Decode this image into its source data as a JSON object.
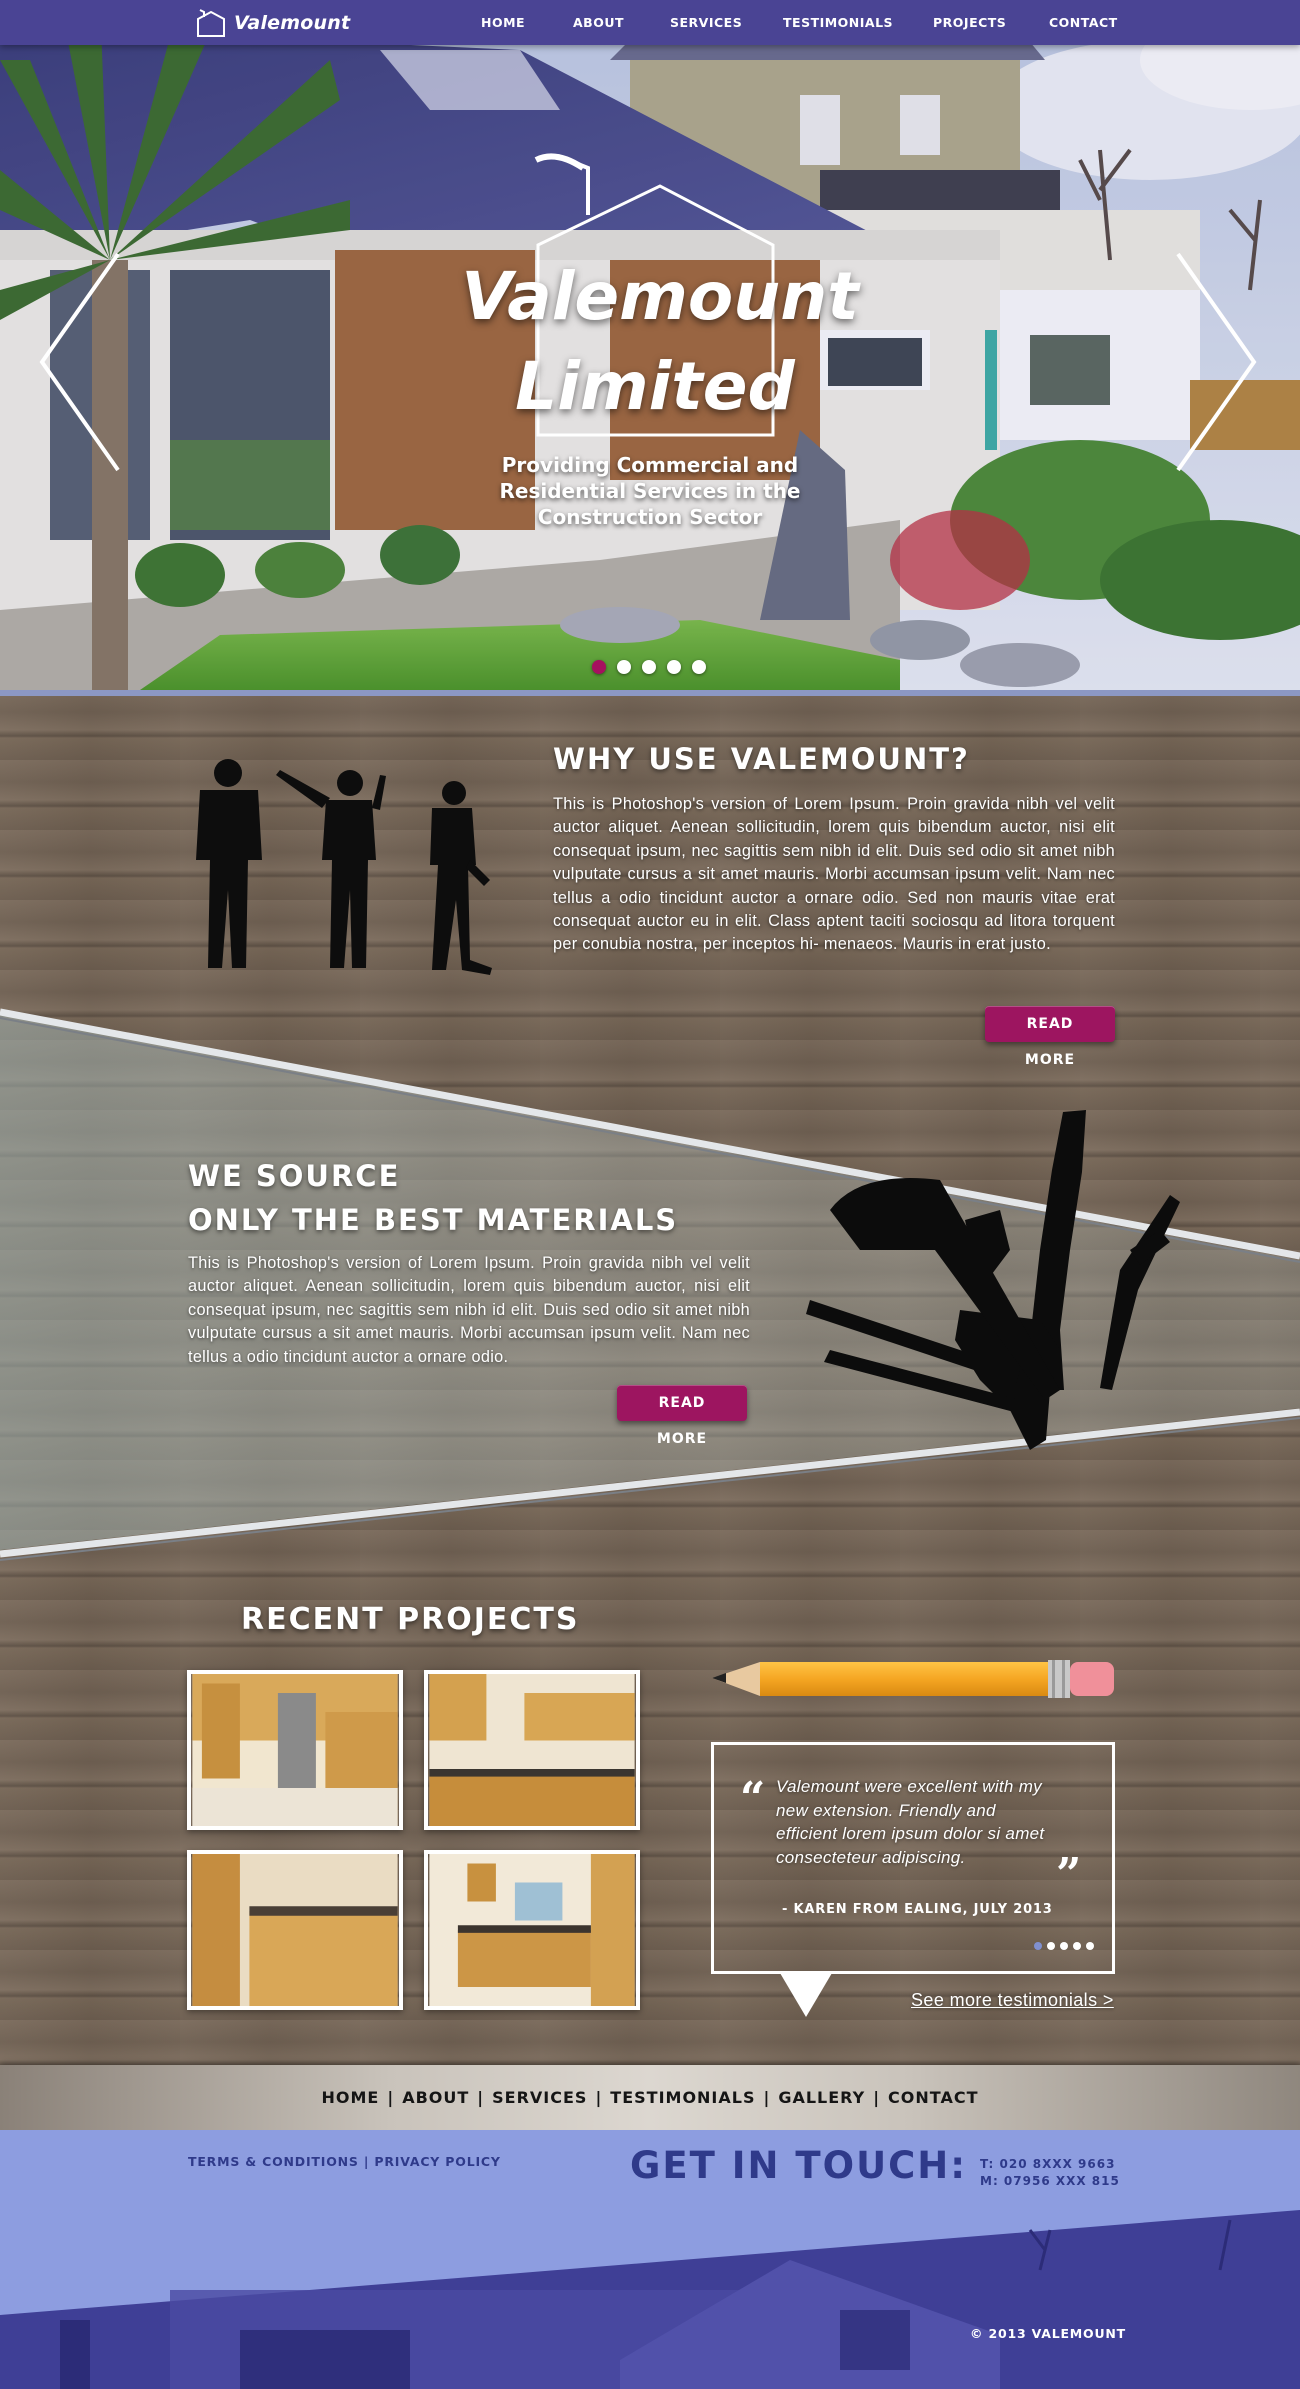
{
  "brand": {
    "name": "Valemount"
  },
  "nav": {
    "items": [
      "HOME",
      "ABOUT",
      "SERVICES",
      "TESTIMONIALS",
      "PROJECTS",
      "CONTACT"
    ]
  },
  "hero": {
    "title_line1": "Valemount",
    "title_line2": "Limited",
    "subtitle": "Providing Commercial and Residential Services in the Construction Sector",
    "slide_count": 5,
    "active_slide": 1
  },
  "why": {
    "heading": "WHY USE VALEMOUNT?",
    "body": "This is Photoshop's version  of Lorem Ipsum. Proin gravida nibh vel velit auctor aliquet. Aenean sollicitudin, lorem quis bibendum auctor, nisi elit consequat ipsum, nec sagittis sem nibh id elit. Duis sed odio sit amet nibh vulputate cursus a sit amet mauris. Morbi accumsan ipsum velit. Nam nec tellus a odio tincidunt auctor a ornare odio. Sed non  mauris vitae erat consequat auctor eu in elit. Class aptent taciti sociosqu ad litora torquent per conubia nostra, per inceptos hi- menaeos. Mauris in erat justo.",
    "button": "READ MORE"
  },
  "materials": {
    "heading_line1": "WE SOURCE",
    "heading_line2": "ONLY THE BEST MATERIALS",
    "body": "This is Photoshop's version  of Lorem Ipsum. Proin gravida nibh vel velit auctor aliquet. Aenean sollicitudin, lorem quis bibendum auctor, nisi elit consequat ipsum, nec sagittis sem nibh id elit. Duis sed odio sit amet nibh vulputate cursus a sit amet mauris. Morbi accumsan ipsum velit. Nam nec tellus a odio tincidunt auctor a ornare odio.",
    "button": "READ MORE"
  },
  "projects": {
    "heading": "RECENT PROJECTS"
  },
  "testimonial": {
    "quote": "Valemount were excellent with my new extension. Friendly and efficient lorem ipsum dolor si amet consecteteur adipiscing.",
    "author": "- KAREN FROM EALING, JULY 2013",
    "open_mark": "“",
    "close_mark": "”",
    "slide_count": 5,
    "active_slide": 1,
    "more_link": "See more testimonials >"
  },
  "footer_nav": {
    "items": [
      "HOME",
      "ABOUT",
      "SERVICES",
      "TESTIMONIALS",
      "GALLERY",
      "CONTACT"
    ],
    "separator": "|"
  },
  "footer": {
    "terms": "TERMS & CONDITIONS",
    "privacy": "PRIVACY POLICY",
    "legal_sep": "|",
    "get_in_touch": "GET IN TOUCH:",
    "phone_t": "T: 020 8XXX 9663",
    "phone_m": "M: 07956 XXX 815",
    "copyright": "© 2013 VALEMOUNT"
  },
  "colors": {
    "nav_bg": "#4a4494",
    "accent": "#9d1560",
    "footer_bg": "#8d9de0",
    "footer_text": "#2f3a8a"
  },
  "icons": [
    "house-logo-icon",
    "chevron-left-icon",
    "chevron-right-icon",
    "quote-open-icon",
    "quote-close-icon",
    "pencil-icon",
    "tools-icon",
    "workers-silhouette-icon"
  ]
}
